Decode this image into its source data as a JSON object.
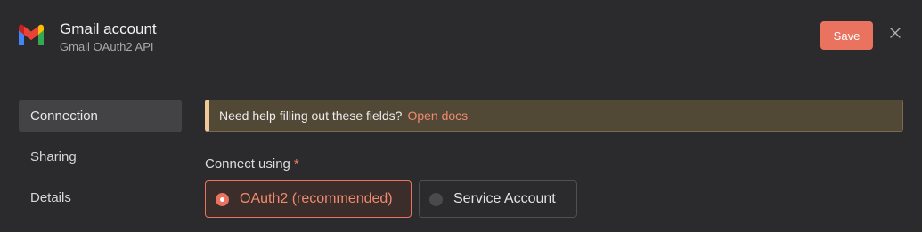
{
  "header": {
    "title": "Gmail account",
    "subtitle": "Gmail OAuth2 API",
    "save_label": "Save",
    "logo_icon": "gmail-logo",
    "close_icon": "close-icon"
  },
  "sidebar": {
    "items": [
      {
        "label": "Connection",
        "active": true
      },
      {
        "label": "Sharing",
        "active": false
      },
      {
        "label": "Details",
        "active": false
      }
    ]
  },
  "main": {
    "notice": {
      "text": "Need help filling out these fields?",
      "link": "Open docs"
    },
    "connect_using": {
      "label": "Connect using",
      "required_mark": "*",
      "options": [
        {
          "label": "OAuth2 (recommended)",
          "selected": true
        },
        {
          "label": "Service Account",
          "selected": false
        }
      ]
    }
  },
  "colors": {
    "accent": "#ea7360",
    "background": "#2b2b2d",
    "notice_bg": "#524836",
    "notice_border": "#f0c89a"
  }
}
